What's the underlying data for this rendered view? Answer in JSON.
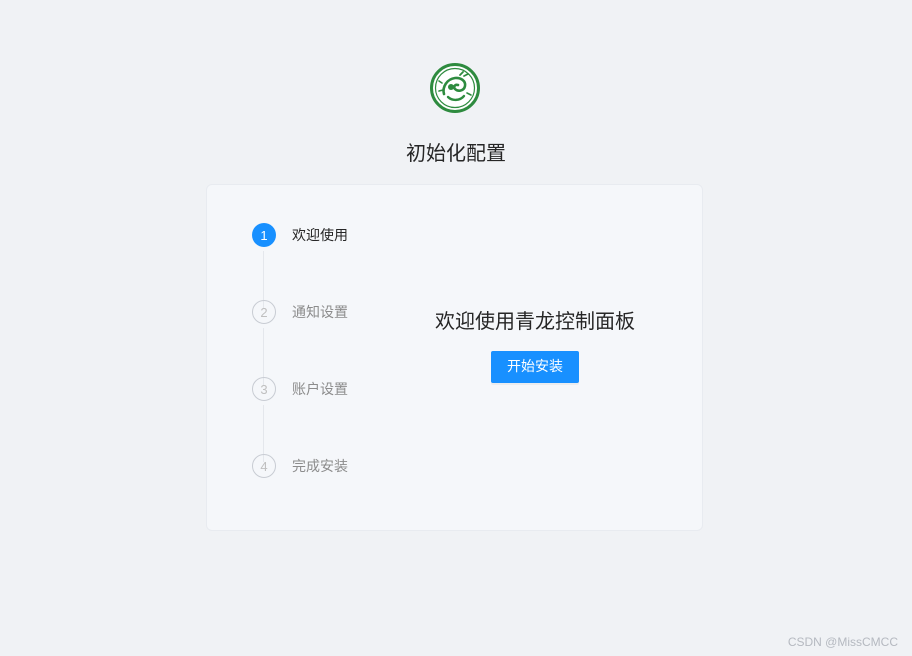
{
  "page": {
    "title": "初始化配置"
  },
  "steps": [
    {
      "number": "1",
      "label": "欢迎使用",
      "status": "active"
    },
    {
      "number": "2",
      "label": "通知设置",
      "status": "wait"
    },
    {
      "number": "3",
      "label": "账户设置",
      "status": "wait"
    },
    {
      "number": "4",
      "label": "完成安装",
      "status": "wait"
    }
  ],
  "welcome": {
    "heading": "欢迎使用青龙控制面板",
    "start_button_label": "开始安装"
  },
  "watermark": "CSDN @MissCMCC",
  "colors": {
    "primary": "#1890ff",
    "logo_green": "#2e8b3f",
    "background": "#f0f2f5"
  },
  "icons": {
    "logo": "qinglong-dragon-logo"
  }
}
